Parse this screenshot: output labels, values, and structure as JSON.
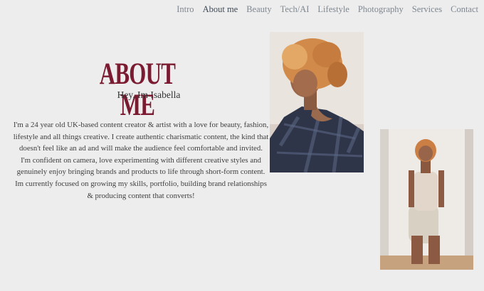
{
  "nav": {
    "items": [
      "Intro",
      "About me",
      "Beauty",
      "Tech/AI",
      "Lifestyle",
      "Photography",
      "Services",
      "Contact"
    ],
    "active": "About me"
  },
  "page": {
    "title": "ABOUT ME",
    "greeting": "Hey, Im Isabella",
    "bio": [
      "I'm a 24 year old UK-based content creator & artist with a love for beauty, fashion, lifestyle and all things creative. I create authentic charismatic content, the kind that doesn't feel like an ad and will make the audience feel comfortable and invited.",
      "I'm confident on camera, love experimenting with different creative styles and genuinely enjoy bringing brands and products to life through short-form content.",
      "Im currently focused on growing my skills, portfolio, building brand relationships & producing content that converts!"
    ]
  },
  "colors": {
    "background": "#ededed",
    "title": "#7a1b31",
    "nav_text": "#7f8791",
    "nav_active": "#3f4a57"
  }
}
